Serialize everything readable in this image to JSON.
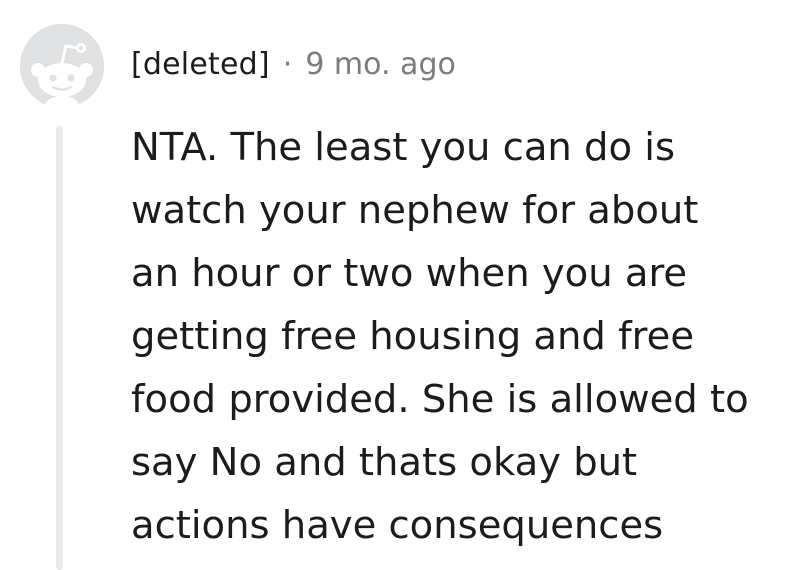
{
  "comment": {
    "author": "[deleted]",
    "separator": "·",
    "timestamp": "9 mo. ago",
    "avatar_icon": "reddit-snoo-icon",
    "body": "NTA. The least you can do is\nwatch your nephew for about\nan hour or two when you are\ngetting free housing and free\nfood provided. She is allowed to\nsay No and thats okay but\nactions have consequences"
  },
  "colors": {
    "text": "#1c1c1c",
    "meta": "#7c7c7c",
    "avatar_bg": "#dfe1e3",
    "thread_line": "#e9eaeb"
  }
}
